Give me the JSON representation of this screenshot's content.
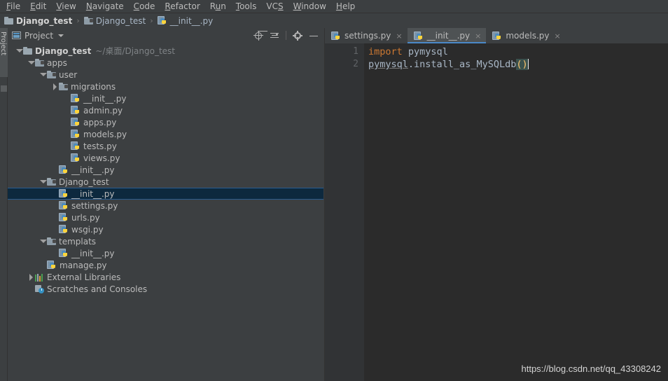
{
  "menu": {
    "items": [
      {
        "label": "File",
        "mnemonic": "F"
      },
      {
        "label": "Edit",
        "mnemonic": "E"
      },
      {
        "label": "View",
        "mnemonic": "V"
      },
      {
        "label": "Navigate",
        "mnemonic": "N"
      },
      {
        "label": "Code",
        "mnemonic": "C"
      },
      {
        "label": "Refactor",
        "mnemonic": "R"
      },
      {
        "label": "Run",
        "mnemonic": "u"
      },
      {
        "label": "Tools",
        "mnemonic": "T"
      },
      {
        "label": "VCS",
        "mnemonic": "S"
      },
      {
        "label": "Window",
        "mnemonic": "W"
      },
      {
        "label": "Help",
        "mnemonic": "H"
      }
    ]
  },
  "breadcrumb": {
    "separator": "›",
    "items": [
      {
        "label": "Django_test",
        "icon": "folder-icon",
        "bold": true
      },
      {
        "label": "Django_test",
        "icon": "folder-module-icon",
        "bold": false
      },
      {
        "label": "__init__.py",
        "icon": "python-file-icon",
        "bold": false
      }
    ]
  },
  "toolstrip": {
    "project_tab_label": "Project"
  },
  "project_panel": {
    "title": "Project",
    "tools": [
      {
        "name": "locate-icon",
        "tooltip": "Select Opened File"
      },
      {
        "name": "collapse-all-icon",
        "tooltip": "Collapse All"
      },
      {
        "name": "settings-gear-icon",
        "tooltip": "Settings"
      },
      {
        "name": "minimize-icon",
        "tooltip": "Hide"
      }
    ],
    "tree": [
      {
        "label": "Django_test",
        "path": "~/桌面/Django_test",
        "icon": "folder-icon",
        "depth": 0,
        "twisty": "down",
        "bold": true,
        "selected": false
      },
      {
        "label": "apps",
        "path": "",
        "icon": "folder-module-icon",
        "depth": 1,
        "twisty": "down",
        "bold": false,
        "selected": false
      },
      {
        "label": "user",
        "path": "",
        "icon": "folder-module-icon",
        "depth": 2,
        "twisty": "down",
        "bold": false,
        "selected": false
      },
      {
        "label": "migrations",
        "path": "",
        "icon": "folder-module-icon",
        "depth": 3,
        "twisty": "right",
        "bold": false,
        "selected": false
      },
      {
        "label": "__init__.py",
        "path": "",
        "icon": "python-file-icon",
        "depth": 4,
        "twisty": "none",
        "bold": false,
        "selected": false
      },
      {
        "label": "admin.py",
        "path": "",
        "icon": "python-file-icon",
        "depth": 4,
        "twisty": "none",
        "bold": false,
        "selected": false
      },
      {
        "label": "apps.py",
        "path": "",
        "icon": "python-file-icon",
        "depth": 4,
        "twisty": "none",
        "bold": false,
        "selected": false
      },
      {
        "label": "models.py",
        "path": "",
        "icon": "python-file-icon",
        "depth": 4,
        "twisty": "none",
        "bold": false,
        "selected": false
      },
      {
        "label": "tests.py",
        "path": "",
        "icon": "python-file-icon",
        "depth": 4,
        "twisty": "none",
        "bold": false,
        "selected": false
      },
      {
        "label": "views.py",
        "path": "",
        "icon": "python-file-icon",
        "depth": 4,
        "twisty": "none",
        "bold": false,
        "selected": false
      },
      {
        "label": "__init__.py",
        "path": "",
        "icon": "python-file-icon",
        "depth": 3,
        "twisty": "none",
        "bold": false,
        "selected": false
      },
      {
        "label": "Django_test",
        "path": "",
        "icon": "folder-module-icon",
        "depth": 2,
        "twisty": "down",
        "bold": false,
        "selected": false
      },
      {
        "label": "__init__.py",
        "path": "",
        "icon": "python-file-icon",
        "depth": 3,
        "twisty": "none",
        "bold": false,
        "selected": true
      },
      {
        "label": "settings.py",
        "path": "",
        "icon": "python-file-icon",
        "depth": 3,
        "twisty": "none",
        "bold": false,
        "selected": false
      },
      {
        "label": "urls.py",
        "path": "",
        "icon": "python-file-icon",
        "depth": 3,
        "twisty": "none",
        "bold": false,
        "selected": false
      },
      {
        "label": "wsgi.py",
        "path": "",
        "icon": "python-file-icon",
        "depth": 3,
        "twisty": "none",
        "bold": false,
        "selected": false
      },
      {
        "label": "templats",
        "path": "",
        "icon": "folder-module-icon",
        "depth": 2,
        "twisty": "down",
        "bold": false,
        "selected": false
      },
      {
        "label": "__init__.py",
        "path": "",
        "icon": "python-file-icon",
        "depth": 3,
        "twisty": "none",
        "bold": false,
        "selected": false
      },
      {
        "label": "manage.py",
        "path": "",
        "icon": "python-file-icon",
        "depth": 2,
        "twisty": "none",
        "bold": false,
        "selected": false
      },
      {
        "label": "External Libraries",
        "path": "",
        "icon": "external-libraries-icon",
        "depth": 1,
        "twisty": "right",
        "bold": false,
        "selected": false
      },
      {
        "label": "Scratches and Consoles",
        "path": "",
        "icon": "scratches-icon",
        "depth": 1,
        "twisty": "none",
        "bold": false,
        "selected": false
      }
    ]
  },
  "editor": {
    "tabs": [
      {
        "label": "settings.py",
        "icon": "python-file-icon",
        "active": false,
        "close": "×"
      },
      {
        "label": "__init__.py",
        "icon": "python-file-icon",
        "active": true,
        "close": "×"
      },
      {
        "label": "models.py",
        "icon": "python-file-icon",
        "active": false,
        "close": "×"
      }
    ],
    "line_numbers": [
      "1",
      "2"
    ],
    "lines": [
      {
        "tokens": [
          {
            "text": "import",
            "style": "kw"
          },
          {
            "text": " ",
            "style": "plain"
          },
          {
            "text": "pymysql",
            "style": "plain"
          }
        ]
      },
      {
        "tokens": [
          {
            "text": "pymysql",
            "style": "link"
          },
          {
            "text": ".install_as_MySQLdb",
            "style": "plain"
          },
          {
            "text": "()",
            "style": "paren"
          }
        ]
      }
    ],
    "colors": {
      "keyword": "#cc7832",
      "text": "#a9b7c6",
      "brace": "#ffc66d",
      "brace_highlight": "#3b514d",
      "background": "#2b2b2b",
      "gutter": "#313335",
      "active_tab_underline": "#4a88c7"
    }
  },
  "watermark": {
    "text": "https://blog.csdn.net/qq_43308242"
  }
}
